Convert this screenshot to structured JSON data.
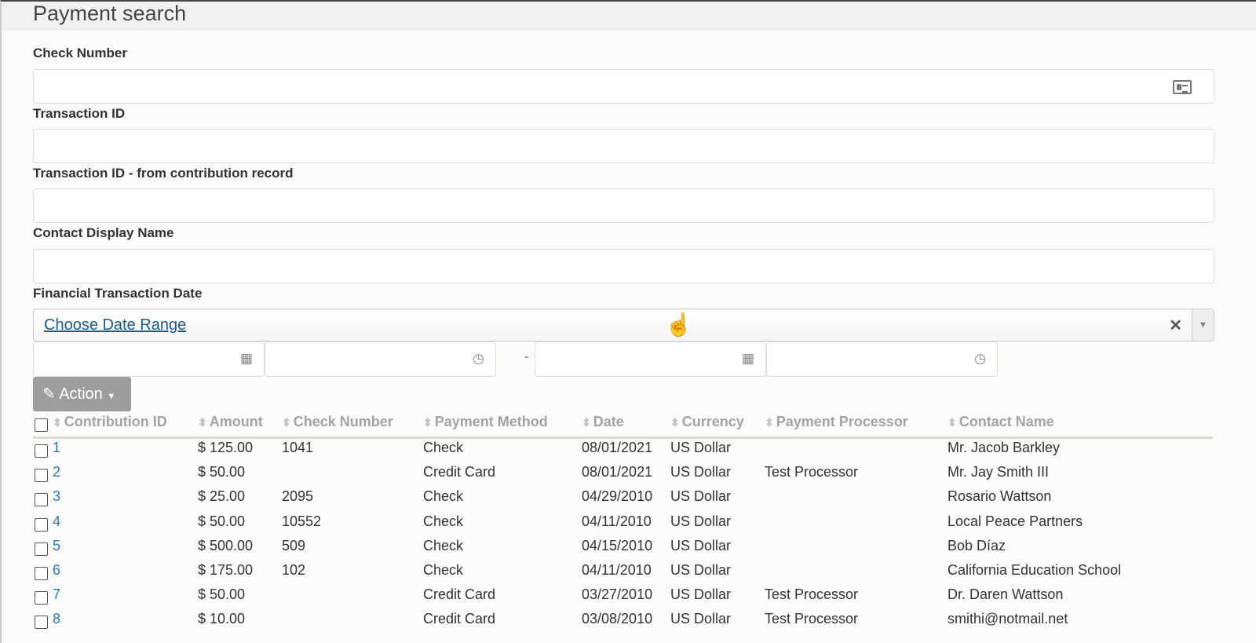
{
  "title": "Payment search",
  "fields": {
    "check_number": "Check Number",
    "transaction_id": "Transaction ID",
    "transaction_id_contrib": "Transaction ID - from contribution record",
    "contact_display_name": "Contact Display Name",
    "financial_transaction_date": "Financial Transaction Date"
  },
  "date_range": {
    "placeholder": "Choose Date Range",
    "separator": "-"
  },
  "action_label": "Action",
  "columns": [
    "Contribution ID",
    "Amount",
    "Check Number",
    "Payment Method",
    "Date",
    "Currency",
    "Payment Processor",
    "Contact Name"
  ],
  "rows": [
    {
      "id": "1",
      "amount": "$ 125.00",
      "check": "1041",
      "method": "Check",
      "date": "08/01/2021",
      "currency": "US Dollar",
      "processor": "",
      "contact": "Mr. Jacob Barkley"
    },
    {
      "id": "2",
      "amount": "$ 50.00",
      "check": "",
      "method": "Credit Card",
      "date": "08/01/2021",
      "currency": "US Dollar",
      "processor": "Test Processor",
      "contact": "Mr. Jay Smith III"
    },
    {
      "id": "3",
      "amount": "$ 25.00",
      "check": "2095",
      "method": "Check",
      "date": "04/29/2010",
      "currency": "US Dollar",
      "processor": "",
      "contact": "Rosario Wattson"
    },
    {
      "id": "4",
      "amount": "$ 50.00",
      "check": "10552",
      "method": "Check",
      "date": "04/11/2010",
      "currency": "US Dollar",
      "processor": "",
      "contact": "Local Peace Partners"
    },
    {
      "id": "5",
      "amount": "$ 500.00",
      "check": "509",
      "method": "Check",
      "date": "04/15/2010",
      "currency": "US Dollar",
      "processor": "",
      "contact": "Bob Díaz"
    },
    {
      "id": "6",
      "amount": "$ 175.00",
      "check": "102",
      "method": "Check",
      "date": "04/11/2010",
      "currency": "US Dollar",
      "processor": "",
      "contact": "California Education School"
    },
    {
      "id": "7",
      "amount": "$ 50.00",
      "check": "",
      "method": "Credit Card",
      "date": "03/27/2010",
      "currency": "US Dollar",
      "processor": "Test Processor",
      "contact": "Dr. Daren Wattson"
    },
    {
      "id": "8",
      "amount": "$ 10.00",
      "check": "",
      "method": "Credit Card",
      "date": "03/08/2010",
      "currency": "US Dollar",
      "processor": "Test Processor",
      "contact": "smithi@notmail.net"
    }
  ]
}
